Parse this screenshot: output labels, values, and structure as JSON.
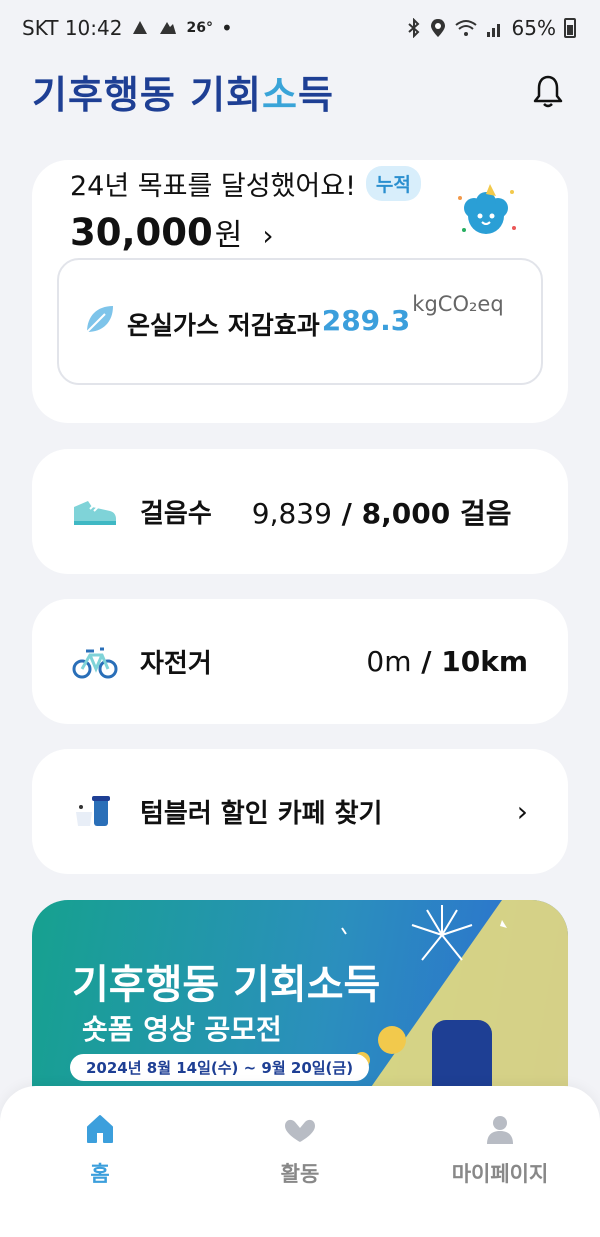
{
  "status_bar": {
    "carrier_time": "SKT 10:42",
    "temperature": "26°",
    "dot": "•",
    "battery": "65%"
  },
  "header": {
    "logo_main": "기후행동 기회",
    "logo_accent": "소",
    "logo_end": "득",
    "icons": {
      "notification": "bell-icon"
    }
  },
  "goal_card": {
    "title": "24년 목표를 달성했어요!",
    "badge": "누적",
    "amount": "30,000",
    "currency": "원",
    "chevron": "›",
    "ghg": {
      "label": "온실가스 저감효과",
      "value": "289.3",
      "unit": "kgCO₂eq"
    }
  },
  "steps_card": {
    "label": "걸음수",
    "current": "9,839",
    "separator": " / ",
    "goal": "8,000 걸음"
  },
  "bike_card": {
    "label": "자전거",
    "current": "0m",
    "separator": " / ",
    "goal": "10km"
  },
  "tumbler_card": {
    "label": "텀블러 할인 카페 찾기",
    "chevron": "›"
  },
  "banner": {
    "title": "기후행동 기회소득",
    "subtitle": "숏폼 영상 공모전",
    "date_range": "2024년 8월 14일(수) ~ 9월 20일(금)"
  },
  "bottom_nav": {
    "items": [
      {
        "label": "홈",
        "icon": "home-icon"
      },
      {
        "label": "활동",
        "icon": "activity-icon"
      },
      {
        "label": "마이페이지",
        "icon": "person-icon"
      }
    ],
    "active_index": 0
  },
  "colors": {
    "accent": "#3c9fdc",
    "logo": "#1e3f94",
    "background": "#f2f3f7"
  }
}
